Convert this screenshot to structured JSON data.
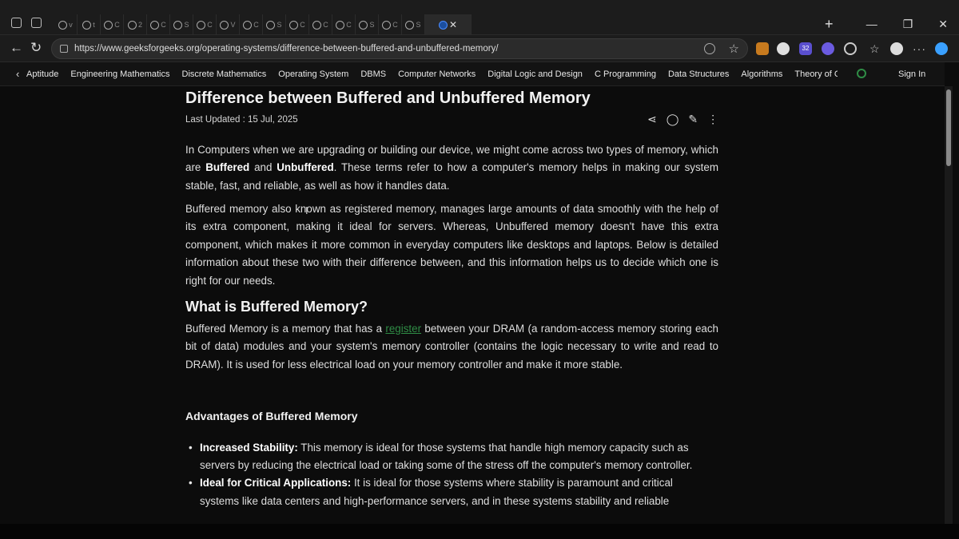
{
  "browser": {
    "url": "https://www.geeksforgeeks.org/operating-systems/difference-between-buffered-and-unbuffered-memory/",
    "extension_badge": "32",
    "tab_letters": [
      "v",
      "t",
      "C",
      "2",
      "C",
      "S",
      "C",
      "V",
      "C",
      "S",
      "C",
      "C",
      "C",
      "S",
      "C",
      "S"
    ]
  },
  "nav": {
    "items": [
      "Aptitude",
      "Engineering Mathematics",
      "Discrete Mathematics",
      "Operating System",
      "DBMS",
      "Computer Networks",
      "Digital Logic and Design",
      "C Programming",
      "Data Structures",
      "Algorithms",
      "Theory of Comp"
    ],
    "signin": "Sign In"
  },
  "article": {
    "title": "Difference between Buffered and Unbuffered Memory",
    "updated": "Last Updated : 15 Jul, 2025",
    "intro": {
      "pre": "In Computers when we are upgrading or building our device, we might come across two types of memory, which are ",
      "b1": "Buffered",
      "mid": " and ",
      "b2": "Unbuffered",
      "post": ". These terms refer to how a computer's memory helps in making our system stable, fast, and reliable, as well as how it handles data."
    },
    "para2": "Buffered memory also known as registered memory, manages large amounts of data smoothly with the help of its extra component, making it ideal for servers. Whereas, Unbuffered memory doesn't have this extra component, which makes it more common in everyday computers like desktops and laptops. Below is detailed information about these two with their difference between, and this information helps us to decide which one is right for our needs.",
    "h2": "What is Buffered Memory?",
    "para3": {
      "pre": "Buffered Memory is a memory that has a ",
      "link": "register",
      "post": " between your DRAM (a random-access memory storing each bit of data) modules and your system's memory controller (contains the logic necessary to write and read to DRAM). It is used for less electrical load on your memory controller and make it more stable."
    },
    "h3": "Advantages of Buffered Memory",
    "advantages": [
      {
        "title": "Increased Stability:",
        "text": " This memory is ideal for those systems that handle high memory capacity such as servers by reducing the electrical load or taking some of the stress off the computer's memory controller."
      },
      {
        "title": "Ideal for Critical Applications:",
        "text": " It is ideal for those systems where stability is paramount and critical systems like data centers and high-performance servers, and in these systems stability and reliable"
      }
    ]
  }
}
